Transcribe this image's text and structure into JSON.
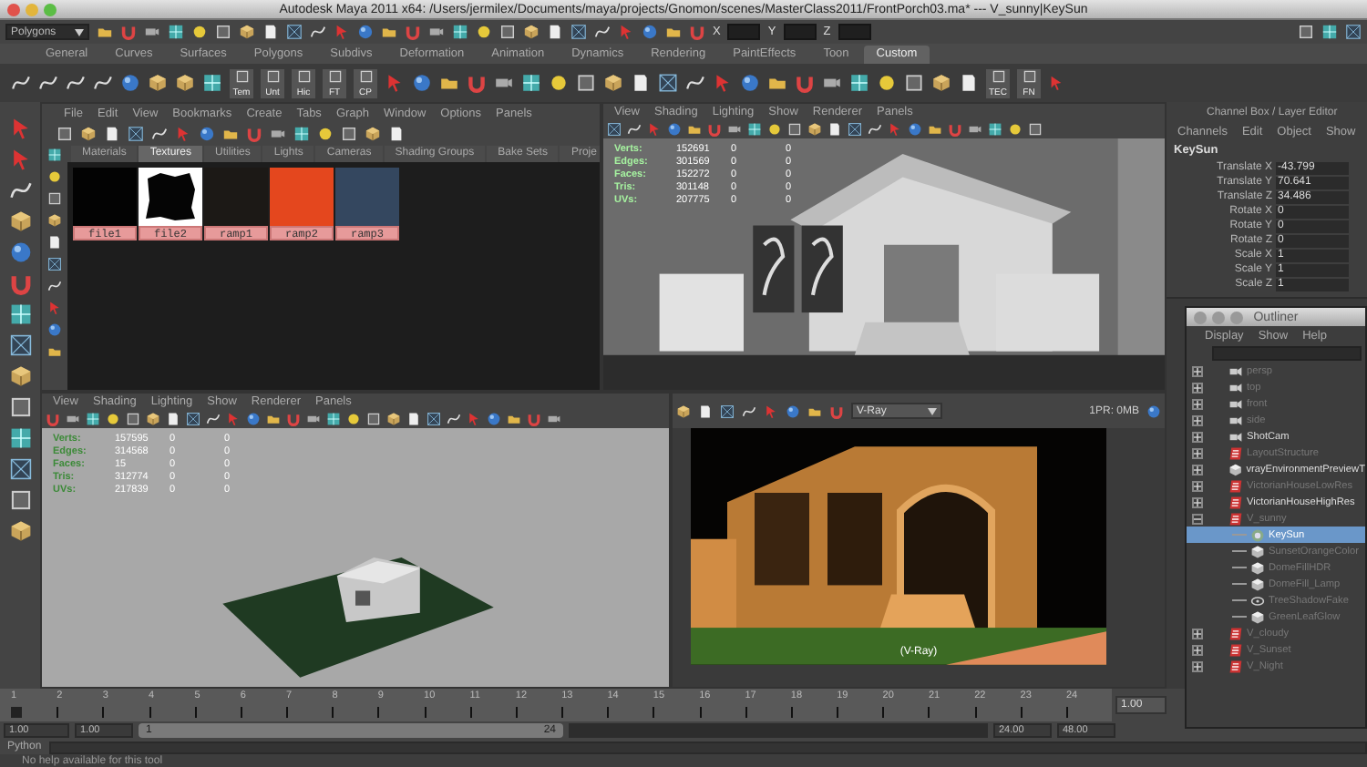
{
  "window": {
    "title": "Autodesk Maya 2011 x64: /Users/jermilex/Documents/maya/projects/Gnomon/scenes/MasterClass2011/FrontPorch03.ma* --- V_sunny|KeySun"
  },
  "status_line": {
    "mode_menu": "Polygons",
    "coord_labels": [
      "X",
      "Y",
      "Z"
    ]
  },
  "shelf_tabs": [
    {
      "label": "General",
      "selected": false
    },
    {
      "label": "Curves",
      "selected": false
    },
    {
      "label": "Surfaces",
      "selected": false
    },
    {
      "label": "Polygons",
      "selected": false
    },
    {
      "label": "Subdivs",
      "selected": false
    },
    {
      "label": "Deformation",
      "selected": false
    },
    {
      "label": "Animation",
      "selected": false
    },
    {
      "label": "Dynamics",
      "selected": false
    },
    {
      "label": "Rendering",
      "selected": false
    },
    {
      "label": "PaintEffects",
      "selected": false
    },
    {
      "label": "Toon",
      "selected": false
    },
    {
      "label": "Custom",
      "selected": true
    }
  ],
  "shelf": {
    "labeled_buttons": [
      "Tem",
      "Unt",
      "Hic",
      "FT",
      "CP",
      "TEC",
      "FN"
    ]
  },
  "hypershade": {
    "menu": [
      "File",
      "Edit",
      "View",
      "Bookmarks",
      "Create",
      "Tabs",
      "Graph",
      "Window",
      "Options",
      "Panels"
    ],
    "tabs": [
      {
        "label": "Materials",
        "selected": false
      },
      {
        "label": "Textures",
        "selected": true
      },
      {
        "label": "Utilities",
        "selected": false
      },
      {
        "label": "Lights",
        "selected": false
      },
      {
        "label": "Cameras",
        "selected": false
      },
      {
        "label": "Shading Groups",
        "selected": false
      },
      {
        "label": "Bake Sets",
        "selected": false
      },
      {
        "label": "Proje",
        "selected": false
      }
    ],
    "swatches": [
      {
        "name": "file1",
        "kind": "solid",
        "color": "#030303"
      },
      {
        "name": "file2",
        "kind": "mask",
        "color": "#050505"
      },
      {
        "name": "ramp1",
        "kind": "solid",
        "color": "#1c1916"
      },
      {
        "name": "ramp2",
        "kind": "solid",
        "color": "#e4471e"
      },
      {
        "name": "ramp3",
        "kind": "solid",
        "color": "#34475f"
      }
    ]
  },
  "persp_view": {
    "menu": [
      "View",
      "Shading",
      "Lighting",
      "Show",
      "Renderer",
      "Panels"
    ],
    "hud": [
      {
        "label": "Verts:",
        "values": [
          "152691",
          "0",
          "0"
        ]
      },
      {
        "label": "Edges:",
        "values": [
          "301569",
          "0",
          "0"
        ]
      },
      {
        "label": "Faces:",
        "values": [
          "152272",
          "0",
          "0"
        ]
      },
      {
        "label": "Tris:",
        "values": [
          "301148",
          "0",
          "0"
        ]
      },
      {
        "label": "UVs:",
        "values": [
          "207775",
          "0",
          "0"
        ]
      }
    ]
  },
  "model_view": {
    "menu": [
      "View",
      "Shading",
      "Lighting",
      "Show",
      "Renderer",
      "Panels"
    ],
    "hud": [
      {
        "label": "Verts:",
        "values": [
          "157595",
          "0",
          "0"
        ]
      },
      {
        "label": "Edges:",
        "values": [
          "314568",
          "0",
          "0"
        ]
      },
      {
        "label": "Faces:",
        "values": [
          "15",
          "0",
          "0"
        ]
      },
      {
        "label": "Tris:",
        "values": [
          "312774",
          "0",
          "0"
        ]
      },
      {
        "label": "UVs:",
        "values": [
          "217839",
          "0",
          "0"
        ]
      }
    ]
  },
  "render_view": {
    "renderer": "V-Ray",
    "memory": "1PR: 0MB",
    "caption": "(V-Ray)"
  },
  "channel_box": {
    "title": "Channel Box / Layer Editor",
    "menu": [
      "Channels",
      "Edit",
      "Object",
      "Show"
    ],
    "object": "KeySun",
    "channels": [
      {
        "name": "Translate X",
        "value": "-43.799"
      },
      {
        "name": "Translate Y",
        "value": "70.641"
      },
      {
        "name": "Translate Z",
        "value": "34.486"
      },
      {
        "name": "Rotate X",
        "value": "0"
      },
      {
        "name": "Rotate Y",
        "value": "0"
      },
      {
        "name": "Rotate Z",
        "value": "0"
      },
      {
        "name": "Scale X",
        "value": "1"
      },
      {
        "name": "Scale Y",
        "value": "1"
      },
      {
        "name": "Scale Z",
        "value": "1"
      }
    ]
  },
  "outliner": {
    "title": "Outliner",
    "menu": [
      "Display",
      "Show",
      "Help"
    ],
    "items": [
      {
        "label": "persp",
        "kind": "camera",
        "dimmed": true,
        "selected": false,
        "expanded": false
      },
      {
        "label": "top",
        "kind": "camera",
        "dimmed": true,
        "selected": false,
        "expanded": false
      },
      {
        "label": "front",
        "kind": "camera",
        "dimmed": true,
        "selected": false,
        "expanded": false
      },
      {
        "label": "side",
        "kind": "camera",
        "dimmed": true,
        "selected": false,
        "expanded": false
      },
      {
        "label": "ShotCam",
        "kind": "camera",
        "dimmed": false,
        "selected": false,
        "expanded": false
      },
      {
        "label": "LayoutStructure",
        "kind": "set",
        "dimmed": true,
        "selected": false,
        "expanded": false
      },
      {
        "label": "vrayEnvironmentPreviewT",
        "kind": "mesh",
        "dimmed": false,
        "selected": false,
        "expanded": false
      },
      {
        "label": "VictorianHouseLowRes",
        "kind": "set",
        "dimmed": true,
        "selected": false,
        "expanded": false
      },
      {
        "label": "VictorianHouseHighRes",
        "kind": "set",
        "dimmed": false,
        "selected": false,
        "expanded": false
      },
      {
        "label": "V_sunny",
        "kind": "set",
        "dimmed": true,
        "selected": false,
        "expanded": true,
        "children": [
          {
            "label": "KeySun",
            "kind": "light",
            "dimmed": false,
            "selected": true
          },
          {
            "label": "SunsetOrangeColor",
            "kind": "mesh",
            "dimmed": true,
            "selected": false
          },
          {
            "label": "DomeFillHDR",
            "kind": "mesh",
            "dimmed": true,
            "selected": false
          },
          {
            "label": "DomeFill_Lamp",
            "kind": "mesh",
            "dimmed": true,
            "selected": false
          },
          {
            "label": "TreeShadowFake",
            "kind": "spot",
            "dimmed": true,
            "selected": false
          },
          {
            "label": "GreenLeafGlow",
            "kind": "mesh",
            "dimmed": true,
            "selected": false
          }
        ]
      },
      {
        "label": "V_cloudy",
        "kind": "set",
        "dimmed": true,
        "selected": false,
        "expanded": false
      },
      {
        "label": "V_Sunset",
        "kind": "set",
        "dimmed": true,
        "selected": false,
        "expanded": false
      },
      {
        "label": "V_Night",
        "kind": "set",
        "dimmed": true,
        "selected": false,
        "expanded": false
      }
    ]
  },
  "timeline": {
    "ticks": [
      {
        "label": "1",
        "selected": true
      },
      {
        "label": "2",
        "selected": false
      },
      {
        "label": "3",
        "selected": false
      },
      {
        "label": "4",
        "selected": false
      },
      {
        "label": "5",
        "selected": false
      },
      {
        "label": "6",
        "selected": false
      },
      {
        "label": "7",
        "selected": false
      },
      {
        "label": "8",
        "selected": false
      },
      {
        "label": "9",
        "selected": false
      },
      {
        "label": "10",
        "selected": false
      },
      {
        "label": "11",
        "selected": false
      },
      {
        "label": "12",
        "selected": false
      },
      {
        "label": "13",
        "selected": false
      },
      {
        "label": "14",
        "selected": false
      },
      {
        "label": "15",
        "selected": false
      },
      {
        "label": "16",
        "selected": false
      },
      {
        "label": "17",
        "selected": false
      },
      {
        "label": "18",
        "selected": false
      },
      {
        "label": "19",
        "selected": false
      },
      {
        "label": "20",
        "selected": false
      },
      {
        "label": "21",
        "selected": false
      },
      {
        "label": "22",
        "selected": false
      },
      {
        "label": "23",
        "selected": false
      },
      {
        "label": "24",
        "selected": false
      }
    ],
    "current_frame": "1.00"
  },
  "range": {
    "level": 1,
    "start": "1.00",
    "range_start": "1.00",
    "slider_start": "1",
    "slider_end": "24",
    "range_end": "24.00",
    "end": "48.00"
  },
  "command_line": {
    "language": "Python"
  },
  "help_line": "No help available for this tool"
}
